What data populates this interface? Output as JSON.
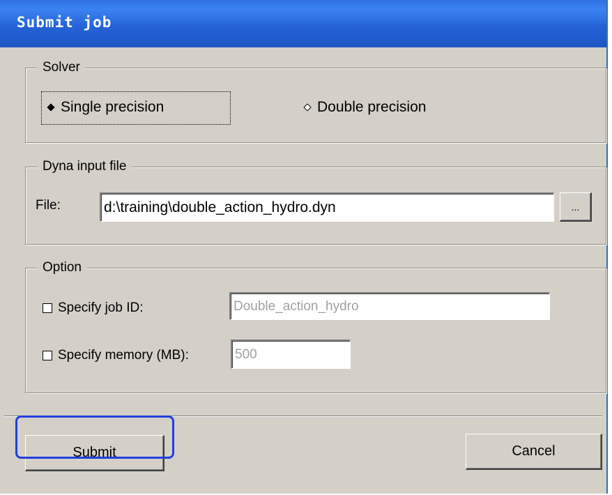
{
  "window": {
    "title": "Submit job"
  },
  "solver": {
    "group_label": "Solver",
    "options": [
      {
        "label": "Single precision",
        "selected": true
      },
      {
        "label": "Double precision",
        "selected": false
      }
    ]
  },
  "input_file": {
    "group_label": "Dyna input file",
    "file_label": "File:",
    "file_value": "d:\\training\\double_action_hydro.dyn",
    "browse_label": "..."
  },
  "option": {
    "group_label": "Option",
    "job_id": {
      "label": "Specify job ID:",
      "checked": false,
      "value": "Double_action_hydro"
    },
    "memory": {
      "label": "Specify memory (MB):",
      "checked": false,
      "value": "500"
    }
  },
  "buttons": {
    "submit": "Submit",
    "cancel": "Cancel"
  },
  "colors": {
    "titlebar": "#2563d6",
    "highlight": "#1f3fe0",
    "dialog_bg": "#d4d0c8"
  }
}
